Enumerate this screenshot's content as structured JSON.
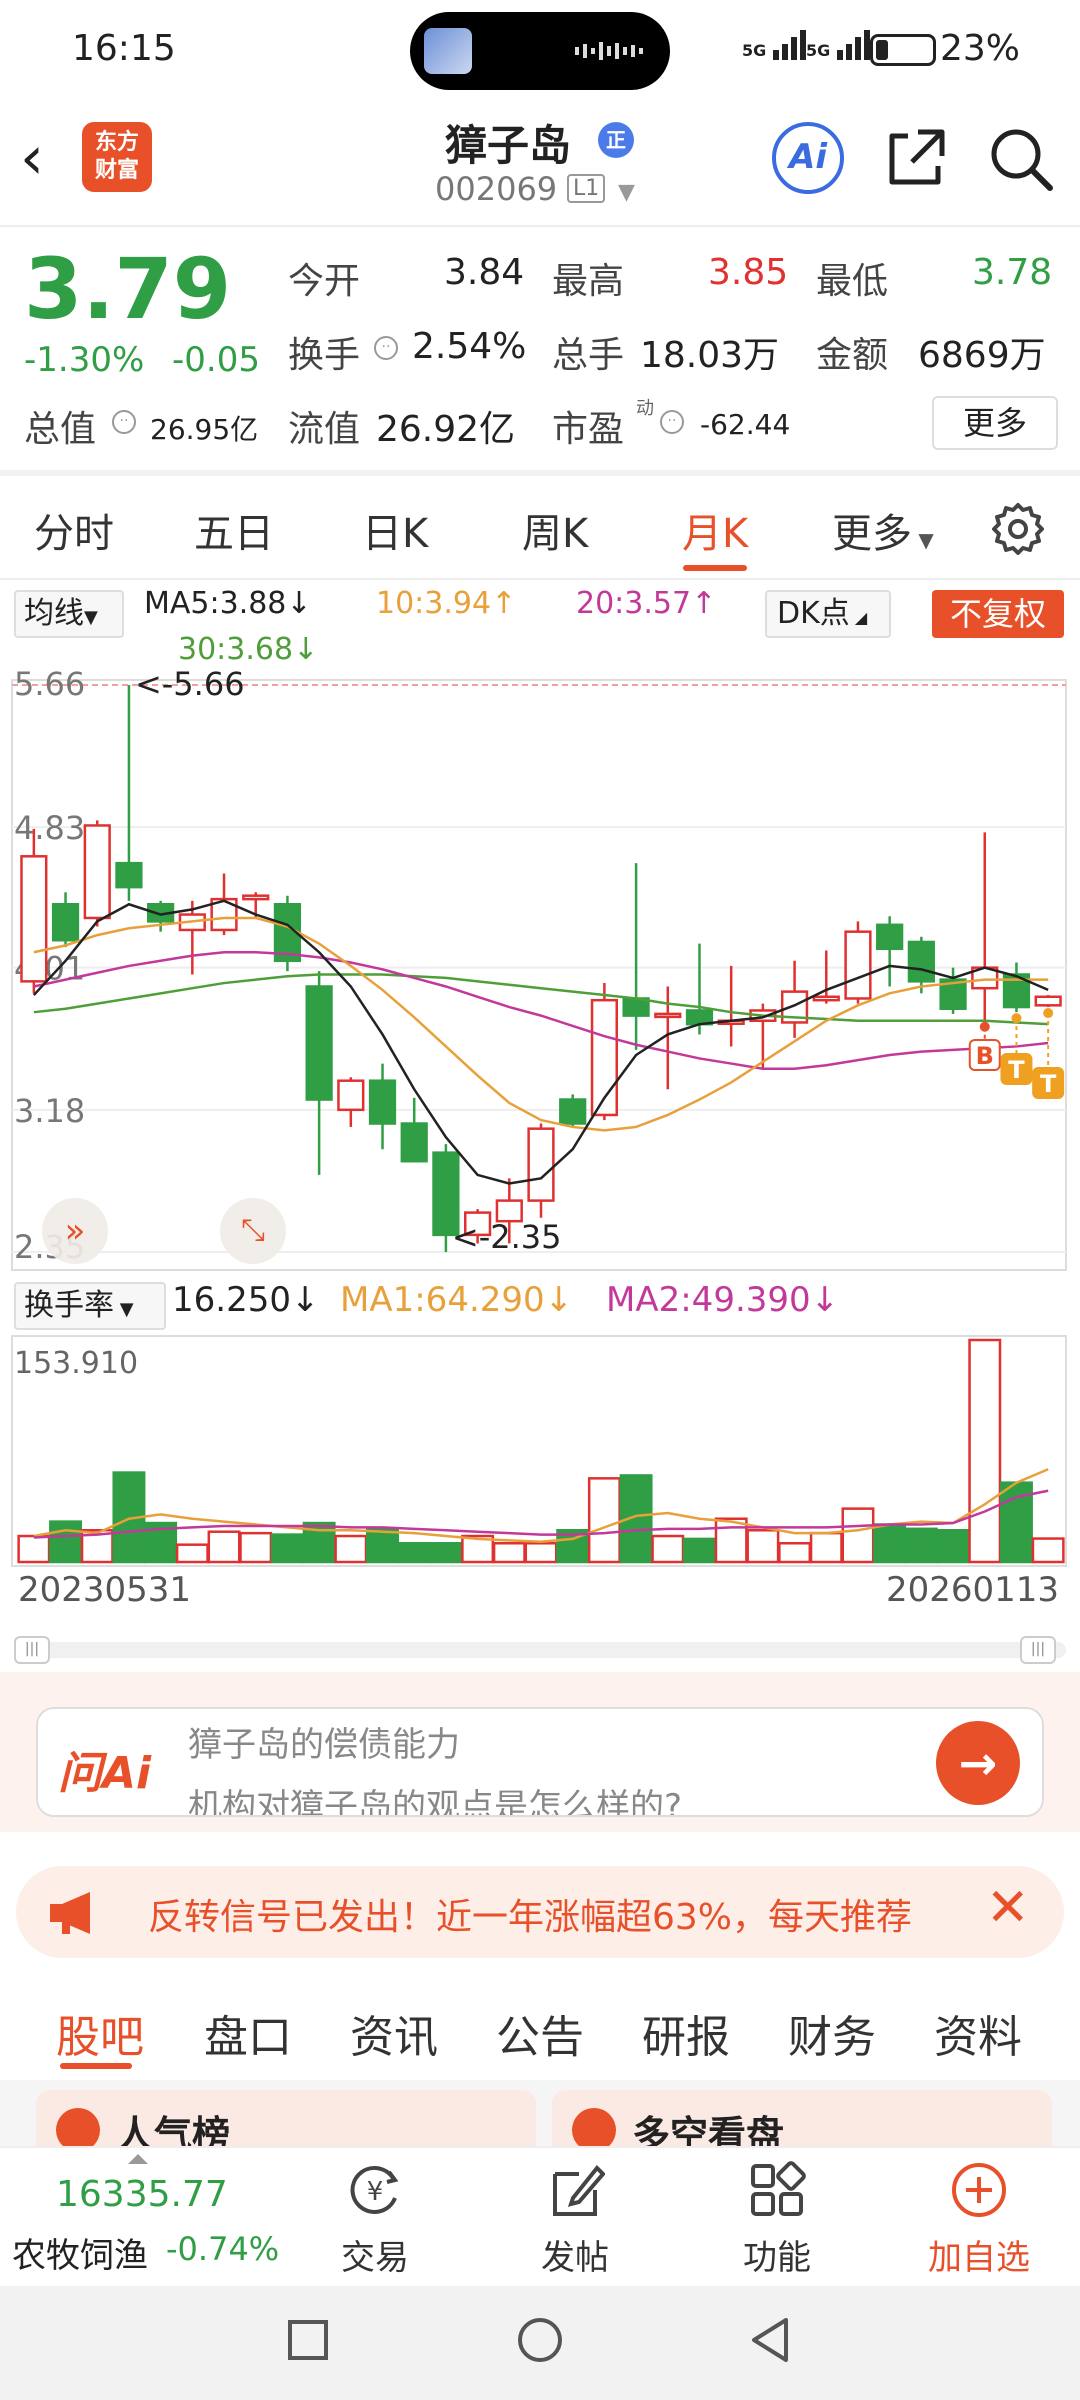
{
  "status_bar": {
    "time": "16:15",
    "sig1": "5G",
    "sig2": "5G",
    "battery": "23%",
    "battery_level": 0.23
  },
  "header": {
    "logo": "东方\n财富",
    "title": "獐子岛",
    "badge": "正",
    "code": "002069",
    "level": "L1"
  },
  "quote": {
    "price": "3.79",
    "pct": "-1.30%",
    "change": "-0.05",
    "open_label": "今开",
    "open": "3.84",
    "high_label": "最高",
    "high": "3.85",
    "low_label": "最低",
    "low": "3.78",
    "turnover_label": "换手",
    "turnover": "2.54%",
    "volume_label": "总手",
    "volume": "18.03万",
    "amount_label": "金额",
    "amount": "6869万",
    "mktcap_label": "总值",
    "mktcap": "26.95亿",
    "float_label": "流值",
    "float": "26.92亿",
    "pe_label": "市盈",
    "pe_sup": "动",
    "pe": "-62.44",
    "more": "更多"
  },
  "tabs": [
    "分时",
    "五日",
    "日K",
    "周K",
    "月K",
    "更多"
  ],
  "active_tab": "月K",
  "chart": {
    "ma_button": "均线",
    "ma5": "MA5:3.88↓",
    "ma10": "10:3.94↑",
    "ma20": "20:3.57↑",
    "ma30": "30:3.68↓",
    "dk_button": "DK点",
    "fq_button": "不复权",
    "y_labels": [
      "5.66",
      "4.83",
      "4.01",
      "3.18",
      "2.35"
    ],
    "max_marker": "<-5.66",
    "min_marker": "<-2.35",
    "markers": [
      "B",
      "T",
      "T"
    ],
    "ind_button": "换手率",
    "ind_value": "16.250↓",
    "ind_ma1": "MA1:64.290↓",
    "ind_ma2": "MA2:49.390↓",
    "ind_max": "153.910",
    "date_start": "20230531",
    "date_end": "20260113",
    "colors": {
      "up": "#e03131",
      "down": "#2f9e44",
      "ma5": "#222222",
      "ma10": "#e8a03a",
      "ma20": "#c2399a",
      "ma30": "#4f9e3a"
    }
  },
  "chart_data": {
    "type": "candlestick",
    "period": "monthly",
    "ylim": [
      2.35,
      5.66
    ],
    "candles": [
      {
        "o": 3.93,
        "h": 4.82,
        "l": 3.86,
        "c": 4.66
      },
      {
        "o": 4.38,
        "h": 4.45,
        "l": 4.13,
        "c": 4.17
      },
      {
        "o": 4.3,
        "h": 4.87,
        "l": 4.25,
        "c": 4.84
      },
      {
        "o": 4.62,
        "h": 5.66,
        "l": 4.4,
        "c": 4.48
      },
      {
        "o": 4.38,
        "h": 4.4,
        "l": 4.22,
        "c": 4.28
      },
      {
        "o": 4.23,
        "h": 4.4,
        "l": 3.97,
        "c": 4.32
      },
      {
        "o": 4.23,
        "h": 4.56,
        "l": 4.2,
        "c": 4.41
      },
      {
        "o": 4.41,
        "h": 4.45,
        "l": 4.3,
        "c": 4.43
      },
      {
        "o": 4.38,
        "h": 4.43,
        "l": 3.99,
        "c": 4.05
      },
      {
        "o": 3.9,
        "h": 3.99,
        "l": 2.8,
        "c": 3.24
      },
      {
        "o": 3.18,
        "h": 3.37,
        "l": 3.08,
        "c": 3.35
      },
      {
        "o": 3.35,
        "h": 3.45,
        "l": 2.95,
        "c": 3.1
      },
      {
        "o": 3.1,
        "h": 3.25,
        "l": 2.88,
        "c": 2.88
      },
      {
        "o": 2.93,
        "h": 2.98,
        "l": 2.35,
        "c": 2.45
      },
      {
        "o": 2.45,
        "h": 2.6,
        "l": 2.4,
        "c": 2.58
      },
      {
        "o": 2.53,
        "h": 2.78,
        "l": 2.4,
        "c": 2.65
      },
      {
        "o": 2.65,
        "h": 3.1,
        "l": 2.55,
        "c": 3.07
      },
      {
        "o": 3.24,
        "h": 3.27,
        "l": 3.08,
        "c": 3.1
      },
      {
        "o": 3.15,
        "h": 3.92,
        "l": 3.12,
        "c": 3.82
      },
      {
        "o": 3.83,
        "h": 4.62,
        "l": 3.53,
        "c": 3.73
      },
      {
        "o": 3.73,
        "h": 3.9,
        "l": 3.3,
        "c": 3.74
      },
      {
        "o": 3.76,
        "h": 4.15,
        "l": 3.62,
        "c": 3.68
      },
      {
        "o": 3.7,
        "h": 4.02,
        "l": 3.55,
        "c": 3.7
      },
      {
        "o": 3.7,
        "h": 3.8,
        "l": 3.42,
        "c": 3.76
      },
      {
        "o": 3.69,
        "h": 4.05,
        "l": 3.6,
        "c": 3.87
      },
      {
        "o": 3.82,
        "h": 4.11,
        "l": 3.8,
        "c": 3.84
      },
      {
        "o": 3.83,
        "h": 4.28,
        "l": 3.8,
        "c": 4.22
      },
      {
        "o": 4.26,
        "h": 4.31,
        "l": 3.9,
        "c": 4.12
      },
      {
        "o": 4.16,
        "h": 4.19,
        "l": 3.86,
        "c": 3.93
      },
      {
        "o": 3.94,
        "h": 4.01,
        "l": 3.74,
        "c": 3.77
      },
      {
        "o": 3.89,
        "h": 4.8,
        "l": 3.7,
        "c": 4.01
      },
      {
        "o": 3.97,
        "h": 4.04,
        "l": 3.75,
        "c": 3.78
      },
      {
        "o": 3.79,
        "h": 3.85,
        "l": 3.78,
        "c": 3.84
      }
    ],
    "ma5": [
      3.85,
      4.05,
      4.28,
      4.38,
      4.32,
      4.35,
      4.4,
      4.32,
      4.26,
      4.1,
      3.9,
      3.62,
      3.3,
      3.02,
      2.8,
      2.75,
      2.78,
      2.95,
      3.25,
      3.5,
      3.62,
      3.68,
      3.7,
      3.72,
      3.79,
      3.88,
      3.95,
      4.02,
      4.0,
      3.95,
      4.01,
      3.96,
      3.88
    ],
    "ma10": [
      4.1,
      4.14,
      4.2,
      4.24,
      4.26,
      4.28,
      4.3,
      4.3,
      4.25,
      4.15,
      4.02,
      3.88,
      3.72,
      3.55,
      3.38,
      3.22,
      3.12,
      3.08,
      3.06,
      3.08,
      3.15,
      3.24,
      3.34,
      3.46,
      3.58,
      3.7,
      3.79,
      3.86,
      3.9,
      3.92,
      3.94,
      3.94,
      3.94
    ],
    "ma20": [
      3.9,
      3.94,
      3.98,
      4.02,
      4.05,
      4.08,
      4.1,
      4.1,
      4.09,
      4.07,
      4.04,
      4.0,
      3.95,
      3.9,
      3.84,
      3.78,
      3.73,
      3.67,
      3.61,
      3.56,
      3.52,
      3.48,
      3.45,
      3.42,
      3.42,
      3.44,
      3.47,
      3.5,
      3.52,
      3.53,
      3.54,
      3.55,
      3.57
    ],
    "ma30": [
      3.75,
      3.77,
      3.8,
      3.83,
      3.86,
      3.89,
      3.92,
      3.94,
      3.96,
      3.97,
      3.97,
      3.97,
      3.96,
      3.95,
      3.93,
      3.91,
      3.89,
      3.87,
      3.85,
      3.83,
      3.8,
      3.78,
      3.75,
      3.73,
      3.72,
      3.71,
      3.7,
      3.7,
      3.7,
      3.7,
      3.7,
      3.69,
      3.68
    ],
    "turnover": [
      18,
      28,
      22,
      62,
      27,
      12,
      21,
      20,
      19,
      27,
      18,
      23,
      13,
      13,
      18,
      13,
      13,
      22,
      58,
      60,
      18,
      16,
      30,
      22,
      13,
      20,
      37,
      26,
      23,
      22,
      153.91,
      55,
      16.25
    ],
    "turnover_ma1": [
      18,
      22,
      20,
      30,
      33,
      30,
      28,
      26,
      24,
      22,
      22,
      21,
      20,
      18,
      16,
      15,
      14,
      16,
      24,
      32,
      34,
      30,
      28,
      24,
      20,
      20,
      22,
      26,
      28,
      27,
      40,
      55,
      64.29
    ],
    "turnover_ma2": [
      17,
      18,
      19,
      21,
      23,
      24,
      25,
      25,
      25,
      25,
      24,
      24,
      23,
      22,
      21,
      20,
      19,
      19,
      20,
      22,
      23,
      23,
      24,
      24,
      24,
      24,
      25,
      26,
      26,
      27,
      35,
      45,
      49.39
    ],
    "turnover_max": 153.91
  },
  "ai_box": {
    "logo": "问Ai",
    "q1": "獐子岛的偿债能力",
    "q2": "机构对獐子岛的观点是怎么样的?"
  },
  "banner": {
    "text": "反转信号已发出！近一年涨幅超63%，每天推荐"
  },
  "sub_tabs": [
    "股吧",
    "盘口",
    "资讯",
    "公告",
    "研报",
    "财务",
    "资料"
  ],
  "cards": [
    "人气榜",
    "多空看盘"
  ],
  "bottom": {
    "index_value": "16335.77",
    "index_name": "农牧饲渔",
    "index_change": "-0.74%",
    "items": [
      "交易",
      "发帖",
      "功能",
      "加自选"
    ]
  }
}
